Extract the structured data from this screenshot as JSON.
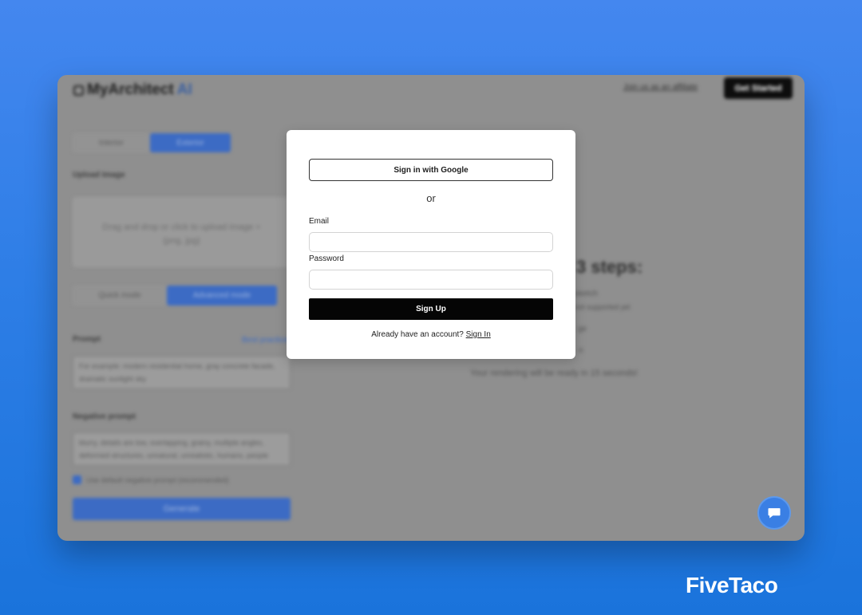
{
  "background_app": {
    "brand": {
      "name": "MyArchitect",
      "suffix": "AI"
    },
    "nav": {
      "affiliate_link": "Join us as an affiliate",
      "get_started": "Get Started"
    },
    "mode_tabs": [
      "Interior",
      "Exterior"
    ],
    "active_mode_tab": "Exterior",
    "upload": {
      "label": "Upload Image",
      "hint": "Drag and drop or click to upload image + (png, jpg)"
    },
    "mode_toggle": [
      "Quick mode",
      "Advanced mode"
    ],
    "active_mode_toggle": "Advanced mode",
    "prompt": {
      "label": "Prompt",
      "best_practices": "Best practices",
      "placeholder": "For example: modern residential home, gray concrete facade, dramatic sunlight sky"
    },
    "negative_prompt": {
      "label": "Negative prompt",
      "value": "blurry, details are low, overlapping, grainy, multiple angles, deformed structures, unnatural, unrealistic, humans, people"
    },
    "default_negative_checkbox": "Use default negative prompt (recommended)",
    "generate_button": "Generate",
    "steps": {
      "title": "3 steps:",
      "lines": [
        "sketch",
        "not supported yet",
        "ge",
        "n",
        "Your rendering will be ready in 15 seconds!"
      ]
    }
  },
  "modal": {
    "google_button": "Sign in with Google",
    "divider": "or",
    "email_label": "Email",
    "email_value": "",
    "password_label": "Password",
    "password_value": "",
    "submit_button": "Sign Up",
    "account_prompt": "Already have an account?",
    "sign_in_link": "Sign In"
  },
  "chat_widget": {
    "icon": "chat-icon"
  },
  "watermark": {
    "text": "FiveTaco"
  },
  "colors": {
    "accent": "#3a7fe4",
    "submit": "#050505",
    "background": "#2e7ee6"
  }
}
